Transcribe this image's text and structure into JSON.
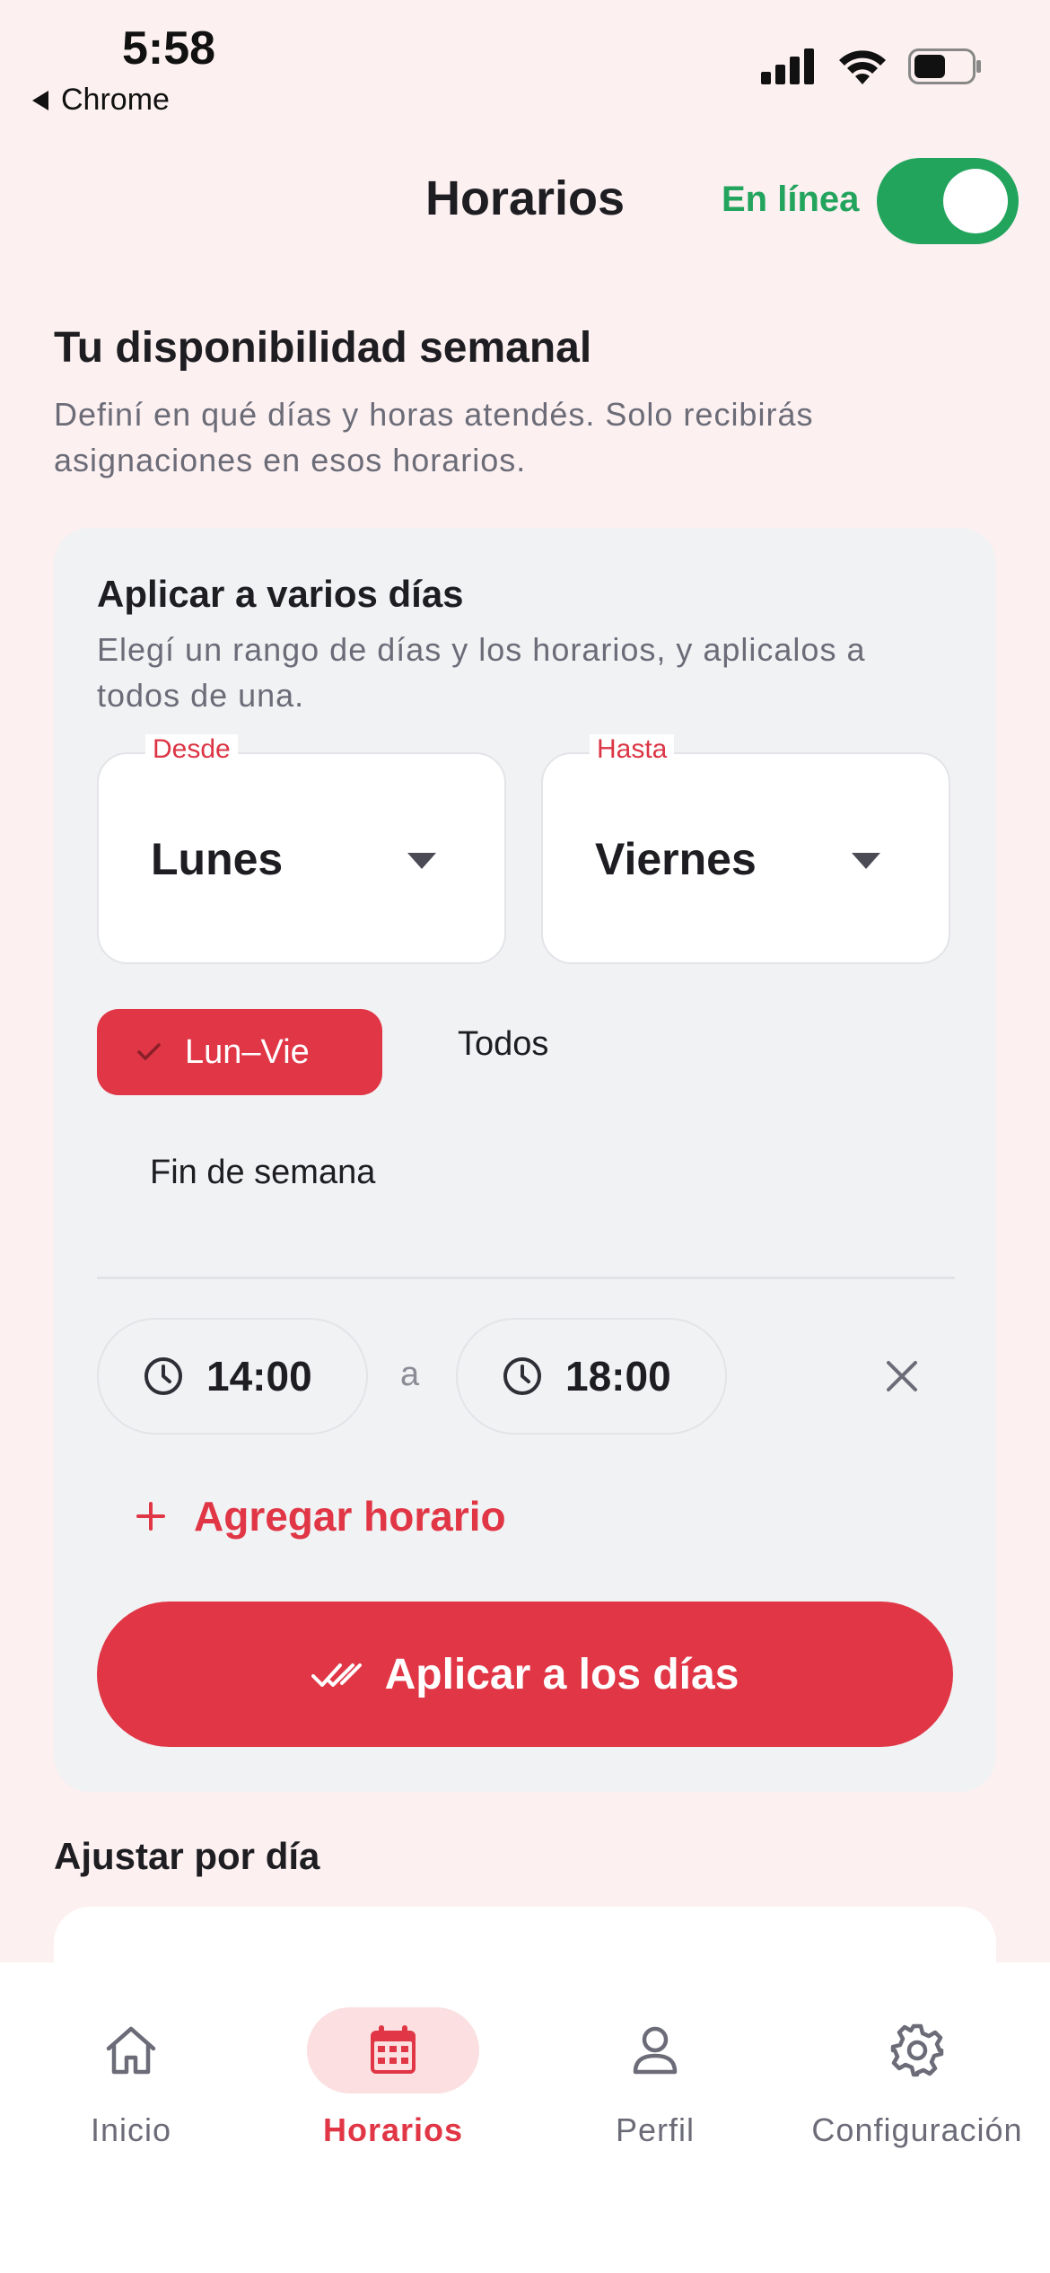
{
  "status_bar": {
    "time": "5:58",
    "back_label": "Chrome",
    "icons": [
      "cellular-signal-icon",
      "wifi-icon",
      "battery-icon"
    ]
  },
  "header": {
    "title": "Horarios",
    "online_label": "En línea",
    "online_toggle_on": true
  },
  "availability": {
    "title": "Tu disponibilidad semanal",
    "description": "Definí en qué días y horas atendés. Solo recibirás asignaciones en esos horarios."
  },
  "bulk_card": {
    "title": "Aplicar a varios días",
    "description": "Elegí un rango de días y los horarios, y aplicalos a todos de una.",
    "from": {
      "legend": "Desde",
      "value": "Lunes"
    },
    "to": {
      "legend": "Hasta",
      "value": "Viernes"
    },
    "presets": [
      {
        "label": "Lun–Vie",
        "selected": true
      },
      {
        "label": "Todos",
        "selected": false
      },
      {
        "label": "Fin de semana",
        "selected": false
      }
    ],
    "time_slot": {
      "start": "14:00",
      "separator": "a",
      "end": "18:00"
    },
    "add_slot_label": "Agregar horario",
    "apply_label": "Aplicar a los días"
  },
  "per_day": {
    "title": "Ajustar por día"
  },
  "bottom_nav": {
    "items": [
      {
        "label": "Inicio",
        "icon": "home-icon",
        "active": false
      },
      {
        "label": "Horarios",
        "icon": "calendar-icon",
        "active": true
      },
      {
        "label": "Perfil",
        "icon": "user-icon",
        "active": false
      },
      {
        "label": "Configuración",
        "icon": "gear-icon",
        "active": false
      }
    ]
  },
  "colors": {
    "background": "#fcf0f0",
    "accent": "#e03645",
    "online_green": "#22a45d",
    "card": "#f1f2f4",
    "muted_text": "#6b6c78"
  }
}
